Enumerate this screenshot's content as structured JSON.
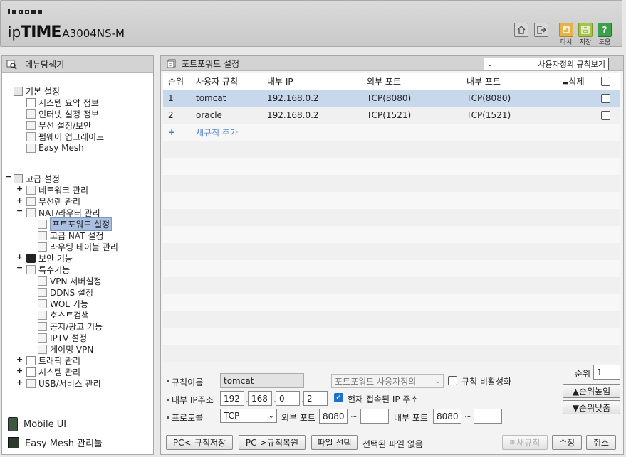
{
  "header": {
    "logo_ip": "ip",
    "logo_time": "TIME",
    "logo_model": "A3004NS-M",
    "buttons": [
      {
        "label": "",
        "icon": "home-icon"
      },
      {
        "label": "",
        "icon": "logout-icon"
      },
      {
        "label": "다시",
        "icon": "refresh-icon"
      },
      {
        "label": "저장",
        "icon": "save-icon"
      },
      {
        "label": "도움",
        "icon": "help-icon"
      }
    ]
  },
  "sidebar": {
    "title": "메뉴탐색기",
    "tree": [
      {
        "label": "기본 설정"
      },
      {
        "label": "시스템 요약 정보"
      },
      {
        "label": "인터넷 설정 정보"
      },
      {
        "label": "무선 설정/보안"
      },
      {
        "label": "펌웨어 업그레이드"
      },
      {
        "label": "Easy Mesh"
      },
      {
        "label": "고급 설정"
      },
      {
        "label": "네트워크 관리"
      },
      {
        "label": "무선랜 관리"
      },
      {
        "label": "NAT/라우터 관리"
      },
      {
        "label": "포트포워드 설정"
      },
      {
        "label": "고급 NAT 설정"
      },
      {
        "label": "라우팅 테이블 관리"
      },
      {
        "label": "보안 기능"
      },
      {
        "label": "특수기능"
      },
      {
        "label": "VPN 서버설정"
      },
      {
        "label": "DDNS 설정"
      },
      {
        "label": "WOL 기능"
      },
      {
        "label": "호스트검색"
      },
      {
        "label": "공지/광고 기능"
      },
      {
        "label": "IPTV 설정"
      },
      {
        "label": "게이밍 VPN"
      },
      {
        "label": "트래픽 관리"
      },
      {
        "label": "시스템 관리"
      },
      {
        "label": "USB/서비스 관리"
      }
    ],
    "footer": {
      "mobile_ui": "Mobile UI",
      "easymesh_tool": "Easy Mesh 관리툴"
    }
  },
  "main": {
    "title": "포트포워드 설정",
    "view_select": "사용자정의 규칙보기",
    "columns": {
      "no": "순위",
      "rule": "사용자 규칙",
      "internal_ip": "내부 IP",
      "external_port": "외부 포트",
      "internal_port": "내부 포트",
      "delete": "삭제"
    },
    "rows": [
      {
        "no": "1",
        "rule": "tomcat",
        "internal_ip": "192.168.0.2",
        "external_port": "TCP(8080)",
        "internal_port": "TCP(8080)"
      },
      {
        "no": "2",
        "rule": "oracle",
        "internal_ip": "192.168.0.2",
        "external_port": "TCP(1521)",
        "internal_port": "TCP(1521)"
      }
    ],
    "add_rule_plus": "+",
    "add_rule": "새규칙 추가"
  },
  "form": {
    "rule_name_label": "규칙이름",
    "rule_name_value": "tomcat",
    "rule_type_select": "포트포워드 사용자정의",
    "disable_rule_label": "규칙 비활성화",
    "internal_ip_label": "내부 IP주소",
    "ip1": "192",
    "ip2": "168",
    "ip3": "0",
    "ip4": "2",
    "current_ip_label": "현재 접속된 IP 주소",
    "protocol_label": "프로토콜",
    "protocol_value": "TCP",
    "ext_port_label": "외부 포트",
    "ext_port_from": "8080",
    "ext_port_to": "",
    "int_port_label": "내부 포트",
    "int_port_from": "8080",
    "int_port_to": "",
    "tilde": "~",
    "rank_label": "순위",
    "rank_value": "1",
    "rank_up": "▲순위높임",
    "rank_down": "▼순위낮춤"
  },
  "bottom_buttons": {
    "backup": "PC<-규칙저장",
    "restore": "PC->규칙복원",
    "file_select": "파일 선택",
    "file_status": "선택된 파일 없음",
    "new_rule": "새규칙",
    "modify": "수정",
    "cancel": "취소"
  }
}
